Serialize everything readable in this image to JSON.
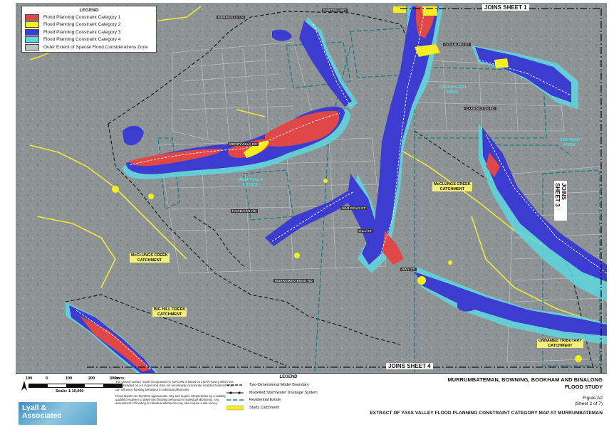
{
  "legend_top": {
    "title": "LEGEND",
    "items": [
      {
        "label": "Flood Planning Constraint Category 1",
        "color": "#e04848"
      },
      {
        "label": "Flood Planning Constraint Category 2",
        "color": "#f5ee1e"
      },
      {
        "label": "Flood Planning Constraint Category 3",
        "color": "#3c3cd0"
      },
      {
        "label": "Flood Planning Constraint Category 4",
        "color": "#5fd6e0"
      },
      {
        "label": "Outer Extent of Special Flood Considerations Zone",
        "color": "#b9c2c7"
      }
    ]
  },
  "sheets": {
    "top": "JOINS SHEET 1",
    "bottom": "JOINS SHEET 4",
    "right": "JOINS SHEET 3"
  },
  "map_labels": {
    "merryville": "MERRYVILLE\nESTATE",
    "mcclungs_right": "McCLUNGS CREEK\nCATCHMENT",
    "mcclungs_left": "McCLUNGS CREEK\nCATCHMENT",
    "big_hill": "BIG HILL CREEK\nCATCHMENT",
    "carrington": "CARRINGTON\nPARK",
    "vineyard": "VINEYARD\nRIDGE",
    "unnamed": "UNNAMED TRIBUTARY\nCATCHMENT"
  },
  "road_labels": {
    "r1": "BARTON HWY",
    "r2": "MERRYVILLE DR",
    "r3": "MARIGOLD ST",
    "r4": "HILL ST",
    "r5": "RWY ST",
    "r6": "MURRUMBATEMAN RD",
    "r7": "FAIRBAIRN RD",
    "r8": "GOULBURN ST",
    "r9": "MERRIVILLE LN",
    "r10": "CARRINGTON RD"
  },
  "scale": {
    "ticks": [
      "100",
      "0",
      "100",
      "200",
      "300m"
    ],
    "caption": "Scale: 1:10,000"
  },
  "note": {
    "heading": "NOTE:",
    "body1": "The ground surface model incorporated in TUFLOW is based on LiDAR survey which has been sampled on a 5 m grid and does not necessarily incorporate localised features which can influence flooding behaviour in individual allotments.",
    "body2": "Flood depths are therefore approximate only and require interpretation by a suitably qualified engineer to determine flooding behaviour in individual allotments. Any assessment of flooding in individual allotments may also require a site survey."
  },
  "logo_text": "Lyall &\nAssociates",
  "legend_bottom": {
    "title": "LEGEND",
    "items": [
      {
        "label": "Two-Dimensional Model Boundary"
      },
      {
        "label": "Modelled Stormwater Drainage System"
      },
      {
        "label": "Residential Estate"
      },
      {
        "label": "Study Catchment"
      }
    ]
  },
  "title_block": {
    "line1": "MURRUMBATEMAN, BOWNING, BOOKHAM AND BINALONG",
    "line2": "FLOOD STUDY",
    "figure": "Figure A2",
    "sheet": "(Sheet 2 of 7)",
    "extract": "EXTRACT OF YASS VALLEY FLOOD PLANNING CONSTRAINT CATEGORY MAP AT MURRUMBATEMAN"
  },
  "colors": {
    "cat1": "#e04848",
    "cat2": "#f5ee1e",
    "cat3": "#3c3cd0",
    "cat4": "#5fd6e0",
    "background": "#8f9496"
  }
}
